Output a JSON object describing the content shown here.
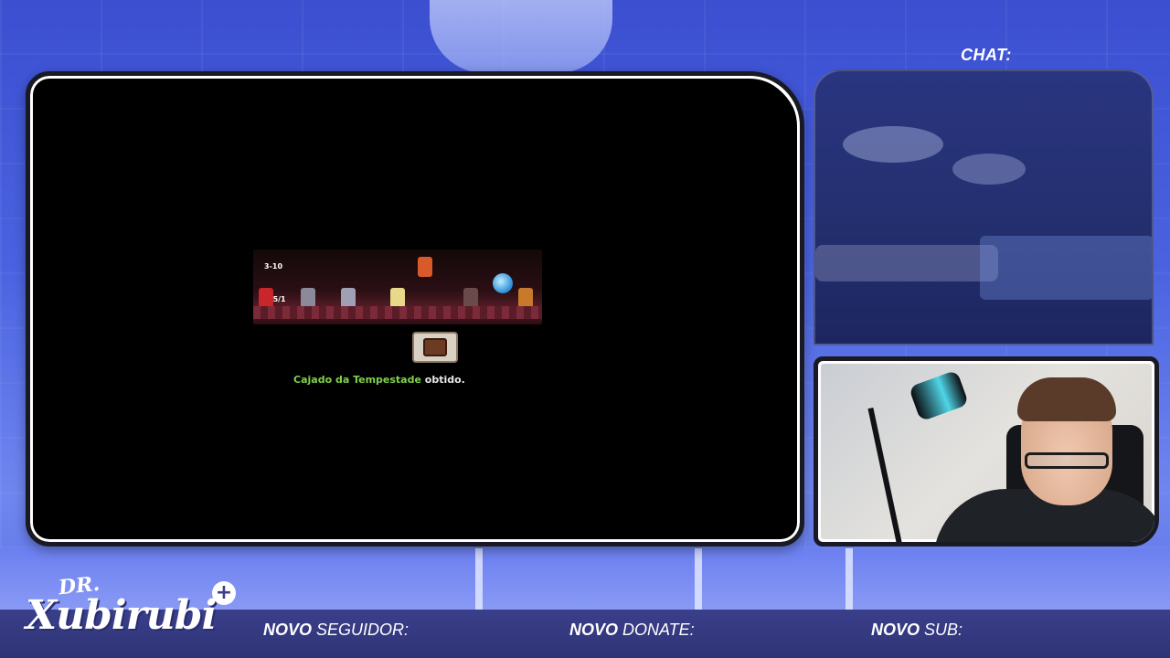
{
  "chat": {
    "title": "CHAT:"
  },
  "game": {
    "stage_label": "3-10",
    "hp_label": "15/1",
    "message_item": "Cajado da Tempestade",
    "message_suffix": " obtido."
  },
  "logo": {
    "prefix": "DR.",
    "name": "Xubirubi",
    "badge": "+"
  },
  "alerts": [
    {
      "strong": "NOVO",
      "rest": " SEGUIDOR:"
    },
    {
      "strong": "NOVO",
      "rest": " DONATE:"
    },
    {
      "strong": "NOVO",
      "rest": " SUB:"
    }
  ],
  "colors": {
    "item_highlight": "#7fd14b",
    "bar": "#2f3376",
    "background": "#4a62e0"
  }
}
